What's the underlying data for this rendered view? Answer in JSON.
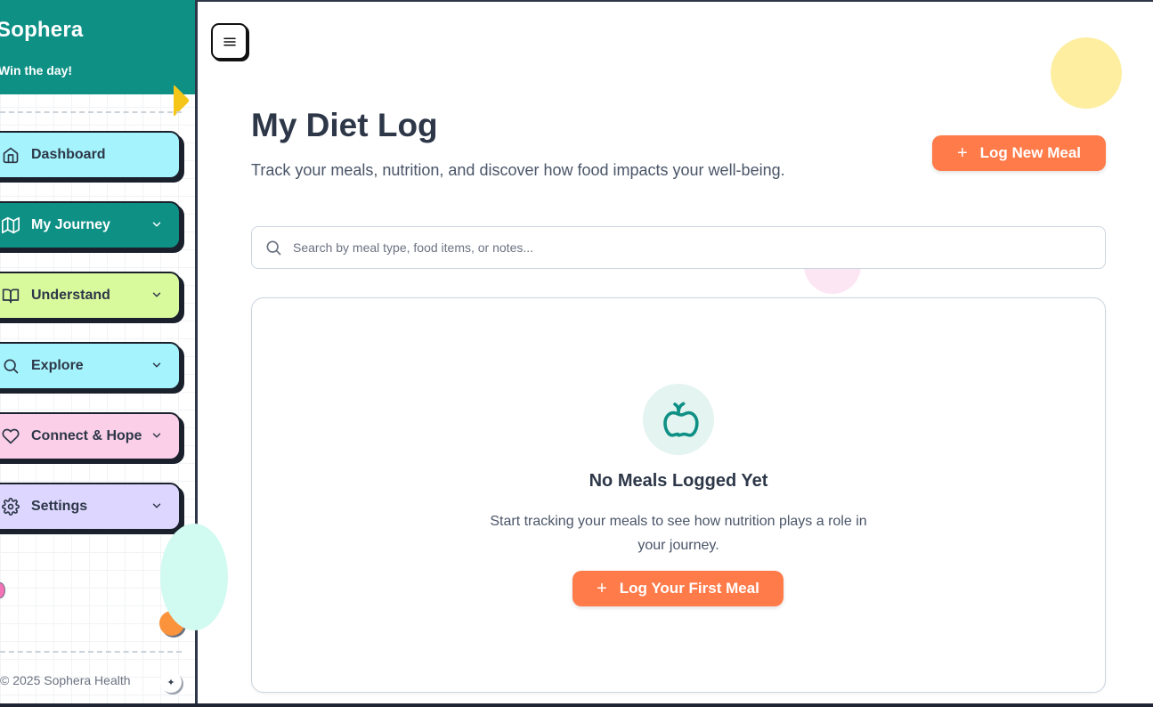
{
  "sidebar": {
    "brand": "Sophera",
    "tagline": "Win the day!",
    "nav": [
      {
        "label": "Dashboard",
        "icon": "home-icon"
      },
      {
        "label": "My Journey",
        "icon": "map-icon"
      },
      {
        "label": "Understand",
        "icon": "book-open-icon"
      },
      {
        "label": "Explore",
        "icon": "search-icon"
      },
      {
        "label": "Connect & Hope",
        "icon": "heart-icon"
      },
      {
        "label": "Settings",
        "icon": "gear-icon"
      }
    ],
    "footer": "© 2025 Sophera Health"
  },
  "main": {
    "title": "My Diet Log",
    "subtitle": "Track your meals, nutrition, and discover how food impacts your well-being.",
    "log_button": "Log New Meal",
    "search_placeholder": "Search by meal type, food items, or notes...",
    "empty": {
      "title": "No Meals Logged Yet",
      "description": "Start tracking your meals to see how nutrition plays a role in your journey.",
      "button": "Log Your First Meal"
    }
  },
  "colors": {
    "brand_teal": "#0f9085",
    "accent_orange": "#ff7b4a"
  }
}
